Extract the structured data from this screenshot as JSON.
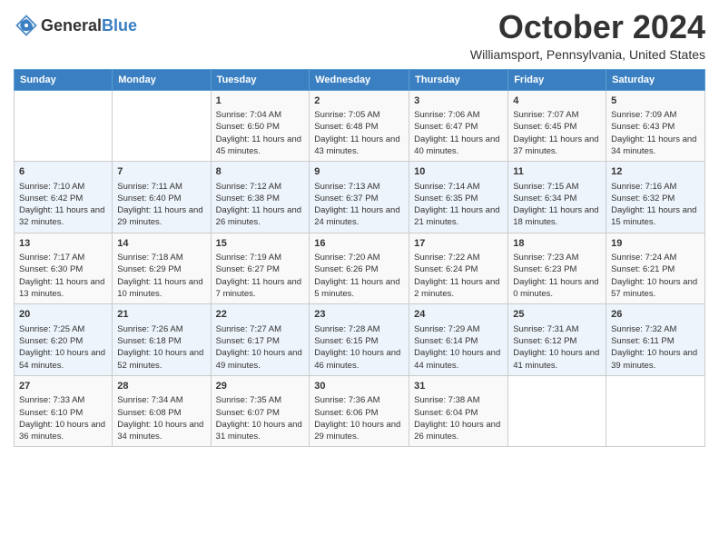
{
  "header": {
    "logo": {
      "general": "General",
      "blue": "Blue"
    },
    "title": "October 2024",
    "location": "Williamsport, Pennsylvania, United States"
  },
  "weekdays": [
    "Sunday",
    "Monday",
    "Tuesday",
    "Wednesday",
    "Thursday",
    "Friday",
    "Saturday"
  ],
  "weeks": [
    [
      {
        "day": "",
        "sunrise": "",
        "sunset": "",
        "daylight": "",
        "empty": true
      },
      {
        "day": "",
        "sunrise": "",
        "sunset": "",
        "daylight": "",
        "empty": true
      },
      {
        "day": "1",
        "sunrise": "Sunrise: 7:04 AM",
        "sunset": "Sunset: 6:50 PM",
        "daylight": "Daylight: 11 hours and 45 minutes."
      },
      {
        "day": "2",
        "sunrise": "Sunrise: 7:05 AM",
        "sunset": "Sunset: 6:48 PM",
        "daylight": "Daylight: 11 hours and 43 minutes."
      },
      {
        "day": "3",
        "sunrise": "Sunrise: 7:06 AM",
        "sunset": "Sunset: 6:47 PM",
        "daylight": "Daylight: 11 hours and 40 minutes."
      },
      {
        "day": "4",
        "sunrise": "Sunrise: 7:07 AM",
        "sunset": "Sunset: 6:45 PM",
        "daylight": "Daylight: 11 hours and 37 minutes."
      },
      {
        "day": "5",
        "sunrise": "Sunrise: 7:09 AM",
        "sunset": "Sunset: 6:43 PM",
        "daylight": "Daylight: 11 hours and 34 minutes."
      }
    ],
    [
      {
        "day": "6",
        "sunrise": "Sunrise: 7:10 AM",
        "sunset": "Sunset: 6:42 PM",
        "daylight": "Daylight: 11 hours and 32 minutes."
      },
      {
        "day": "7",
        "sunrise": "Sunrise: 7:11 AM",
        "sunset": "Sunset: 6:40 PM",
        "daylight": "Daylight: 11 hours and 29 minutes."
      },
      {
        "day": "8",
        "sunrise": "Sunrise: 7:12 AM",
        "sunset": "Sunset: 6:38 PM",
        "daylight": "Daylight: 11 hours and 26 minutes."
      },
      {
        "day": "9",
        "sunrise": "Sunrise: 7:13 AM",
        "sunset": "Sunset: 6:37 PM",
        "daylight": "Daylight: 11 hours and 24 minutes."
      },
      {
        "day": "10",
        "sunrise": "Sunrise: 7:14 AM",
        "sunset": "Sunset: 6:35 PM",
        "daylight": "Daylight: 11 hours and 21 minutes."
      },
      {
        "day": "11",
        "sunrise": "Sunrise: 7:15 AM",
        "sunset": "Sunset: 6:34 PM",
        "daylight": "Daylight: 11 hours and 18 minutes."
      },
      {
        "day": "12",
        "sunrise": "Sunrise: 7:16 AM",
        "sunset": "Sunset: 6:32 PM",
        "daylight": "Daylight: 11 hours and 15 minutes."
      }
    ],
    [
      {
        "day": "13",
        "sunrise": "Sunrise: 7:17 AM",
        "sunset": "Sunset: 6:30 PM",
        "daylight": "Daylight: 11 hours and 13 minutes."
      },
      {
        "day": "14",
        "sunrise": "Sunrise: 7:18 AM",
        "sunset": "Sunset: 6:29 PM",
        "daylight": "Daylight: 11 hours and 10 minutes."
      },
      {
        "day": "15",
        "sunrise": "Sunrise: 7:19 AM",
        "sunset": "Sunset: 6:27 PM",
        "daylight": "Daylight: 11 hours and 7 minutes."
      },
      {
        "day": "16",
        "sunrise": "Sunrise: 7:20 AM",
        "sunset": "Sunset: 6:26 PM",
        "daylight": "Daylight: 11 hours and 5 minutes."
      },
      {
        "day": "17",
        "sunrise": "Sunrise: 7:22 AM",
        "sunset": "Sunset: 6:24 PM",
        "daylight": "Daylight: 11 hours and 2 minutes."
      },
      {
        "day": "18",
        "sunrise": "Sunrise: 7:23 AM",
        "sunset": "Sunset: 6:23 PM",
        "daylight": "Daylight: 11 hours and 0 minutes."
      },
      {
        "day": "19",
        "sunrise": "Sunrise: 7:24 AM",
        "sunset": "Sunset: 6:21 PM",
        "daylight": "Daylight: 10 hours and 57 minutes."
      }
    ],
    [
      {
        "day": "20",
        "sunrise": "Sunrise: 7:25 AM",
        "sunset": "Sunset: 6:20 PM",
        "daylight": "Daylight: 10 hours and 54 minutes."
      },
      {
        "day": "21",
        "sunrise": "Sunrise: 7:26 AM",
        "sunset": "Sunset: 6:18 PM",
        "daylight": "Daylight: 10 hours and 52 minutes."
      },
      {
        "day": "22",
        "sunrise": "Sunrise: 7:27 AM",
        "sunset": "Sunset: 6:17 PM",
        "daylight": "Daylight: 10 hours and 49 minutes."
      },
      {
        "day": "23",
        "sunrise": "Sunrise: 7:28 AM",
        "sunset": "Sunset: 6:15 PM",
        "daylight": "Daylight: 10 hours and 46 minutes."
      },
      {
        "day": "24",
        "sunrise": "Sunrise: 7:29 AM",
        "sunset": "Sunset: 6:14 PM",
        "daylight": "Daylight: 10 hours and 44 minutes."
      },
      {
        "day": "25",
        "sunrise": "Sunrise: 7:31 AM",
        "sunset": "Sunset: 6:12 PM",
        "daylight": "Daylight: 10 hours and 41 minutes."
      },
      {
        "day": "26",
        "sunrise": "Sunrise: 7:32 AM",
        "sunset": "Sunset: 6:11 PM",
        "daylight": "Daylight: 10 hours and 39 minutes."
      }
    ],
    [
      {
        "day": "27",
        "sunrise": "Sunrise: 7:33 AM",
        "sunset": "Sunset: 6:10 PM",
        "daylight": "Daylight: 10 hours and 36 minutes."
      },
      {
        "day": "28",
        "sunrise": "Sunrise: 7:34 AM",
        "sunset": "Sunset: 6:08 PM",
        "daylight": "Daylight: 10 hours and 34 minutes."
      },
      {
        "day": "29",
        "sunrise": "Sunrise: 7:35 AM",
        "sunset": "Sunset: 6:07 PM",
        "daylight": "Daylight: 10 hours and 31 minutes."
      },
      {
        "day": "30",
        "sunrise": "Sunrise: 7:36 AM",
        "sunset": "Sunset: 6:06 PM",
        "daylight": "Daylight: 10 hours and 29 minutes."
      },
      {
        "day": "31",
        "sunrise": "Sunrise: 7:38 AM",
        "sunset": "Sunset: 6:04 PM",
        "daylight": "Daylight: 10 hours and 26 minutes."
      },
      {
        "day": "",
        "sunrise": "",
        "sunset": "",
        "daylight": "",
        "empty": true
      },
      {
        "day": "",
        "sunrise": "",
        "sunset": "",
        "daylight": "",
        "empty": true
      }
    ]
  ]
}
